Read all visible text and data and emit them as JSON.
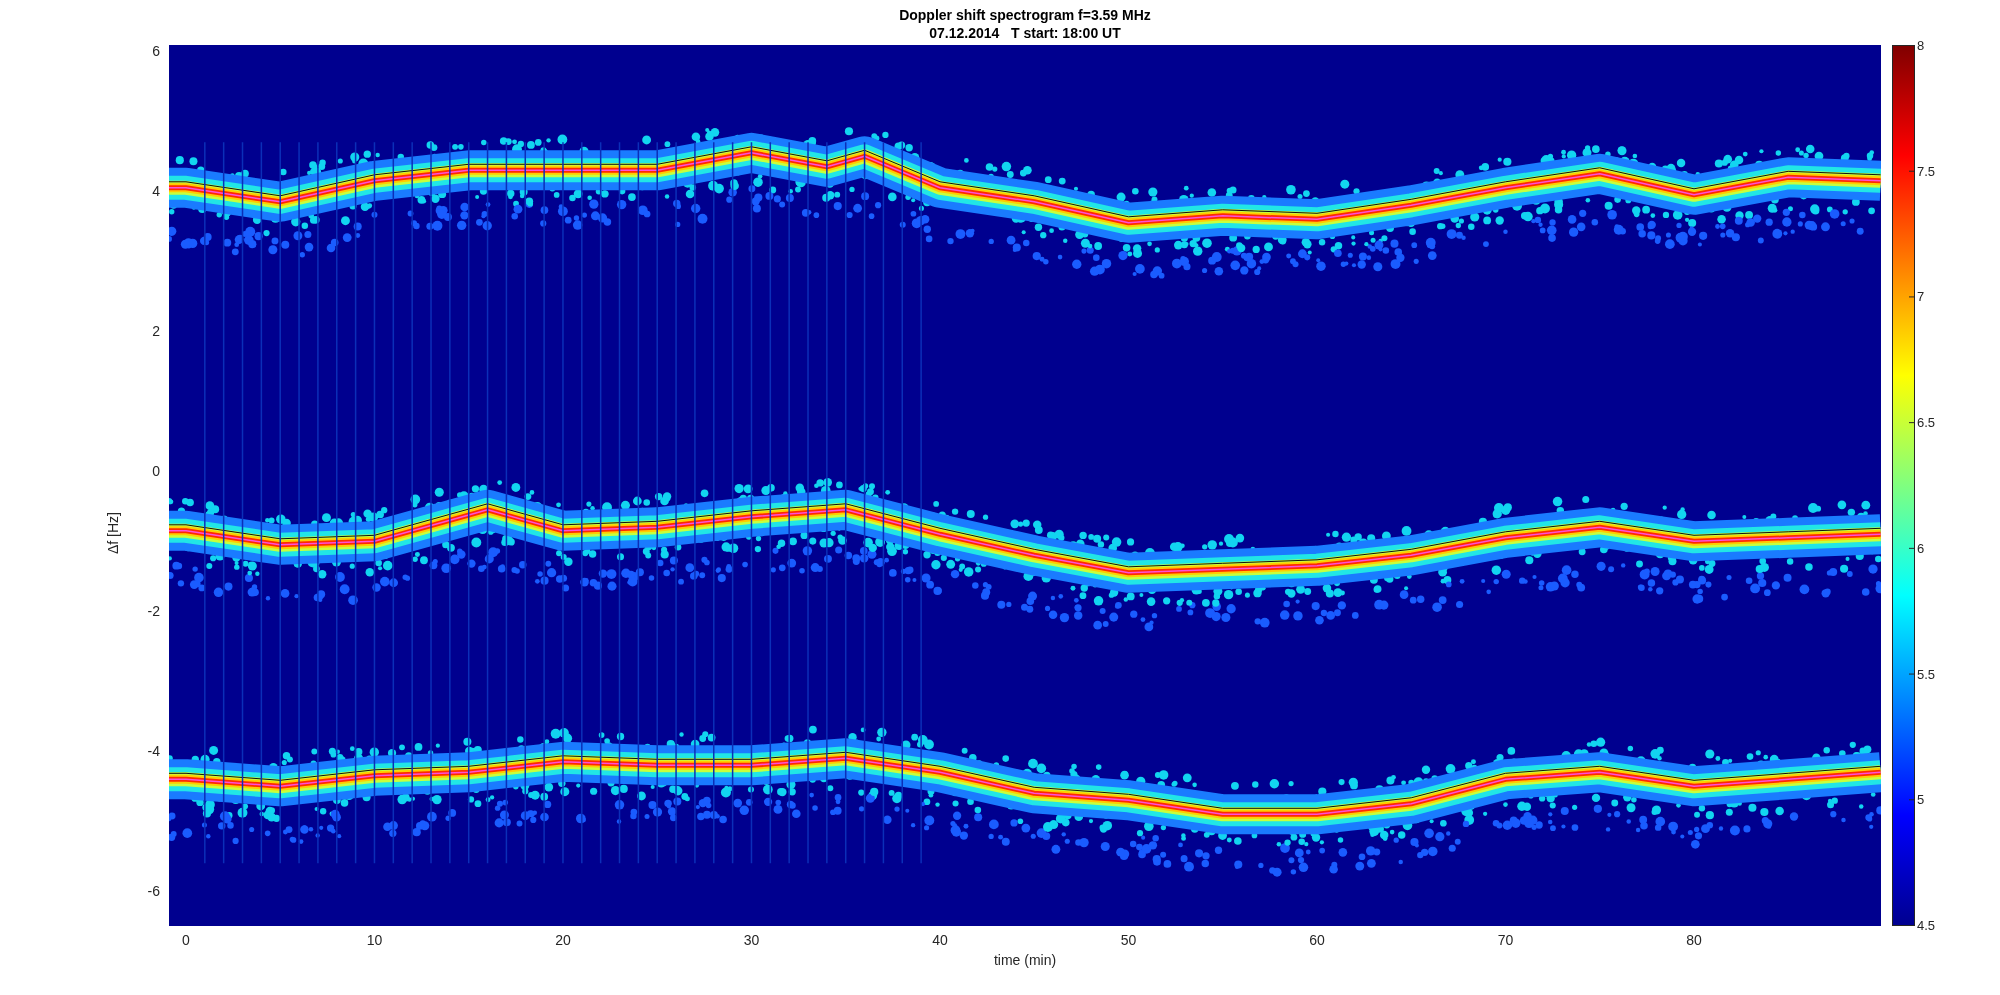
{
  "figure": {
    "title": [
      "Doppler shift spectrogram f=3.59 MHz",
      "07.12.2014   T start: 18:00 UT"
    ],
    "xlabel": "time (min)",
    "ylabel": "Δf [Hz]",
    "xticks": [
      "0",
      "10",
      "20",
      "30",
      "40",
      "50",
      "60",
      "70",
      "80"
    ],
    "yticks": [
      "6",
      "4",
      "2",
      "0",
      "-2",
      "-4",
      "-6"
    ]
  },
  "colorbar": {
    "ticks": [
      "8",
      "7.5",
      "7",
      "6.5",
      "6",
      "5.5",
      "5",
      "4.5"
    ]
  }
}
